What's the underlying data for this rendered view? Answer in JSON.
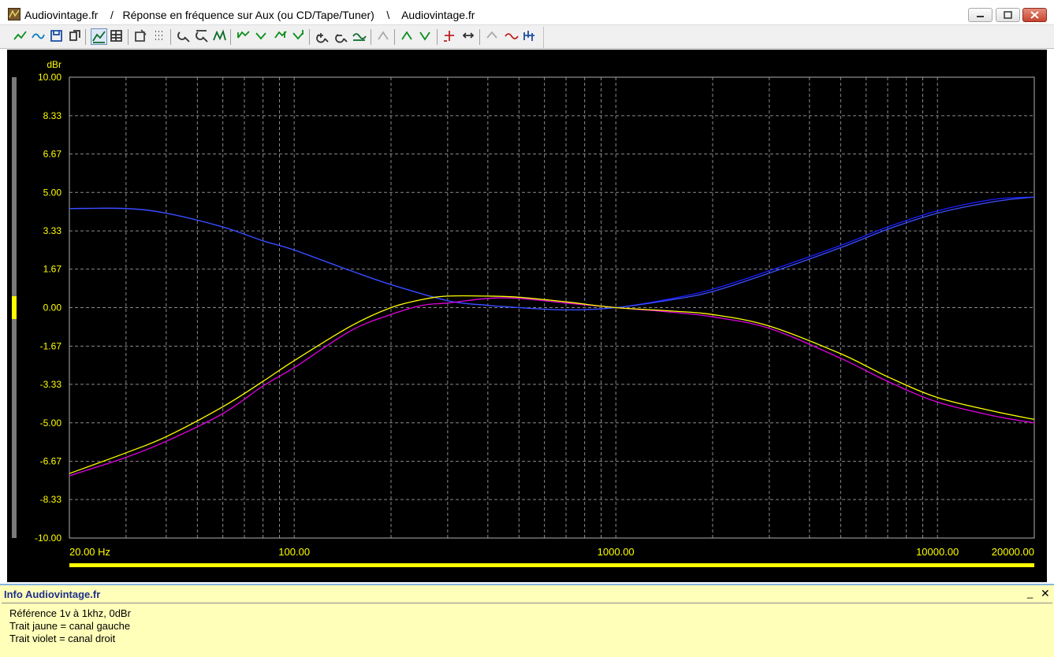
{
  "window": {
    "title": "Audiovintage.fr    /   Réponse en fréquence sur Aux (ou CD/Tape/Tuner)    \\    Audiovintage.fr",
    "accent_color": "#c7452f"
  },
  "toolbar": {
    "icons": [
      "curve-add-icon",
      "curve-smooth-icon",
      "save-icon",
      "copy-icon",
      "fill-graph-icon",
      "chart-table-icon",
      "edit-icon",
      "grid-dots-icon",
      "zoom-fit-icon",
      "zoom-area-icon",
      "curve-view-icon",
      "peak-left-icon",
      "peak-down-icon",
      "peak-right-icon",
      "peak-select-icon",
      "zoom-in-icon",
      "zoom-out-icon",
      "normalize-icon",
      "disabled-tool-icon",
      "peak-up-icon",
      "valley-icon",
      "markers-icon",
      "marker-move-icon",
      "disabled-arrow-icon",
      "wave-icon",
      "align-icon"
    ]
  },
  "chart_data": {
    "type": "line",
    "ylabel": "dBr",
    "ylim": [
      -10,
      10
    ],
    "xlim": [
      20,
      20000
    ],
    "x_scale": "log",
    "y_ticks": [
      "10.00",
      "8.33",
      "6.67",
      "5.00",
      "3.33",
      "1.67",
      "0.00",
      "-1.67",
      "-3.33",
      "-5.00",
      "-6.67",
      "-8.33",
      "-10.00"
    ],
    "x_ticks": [
      {
        "value": 20,
        "label": "20.00 Hz"
      },
      {
        "value": 100,
        "label": "100.00"
      },
      {
        "value": 1000,
        "label": "1000.00"
      },
      {
        "value": 10000,
        "label": "10000.00"
      },
      {
        "value": 20000,
        "label": "20000.00"
      }
    ],
    "grid": true,
    "background": "#000000",
    "axis_text_color": "#ffff00",
    "grid_color": "#8a8a8a",
    "series": [
      {
        "color": "#1c1cff",
        "points": [
          [
            20,
            4.3
          ],
          [
            30,
            4.3
          ],
          [
            40,
            4.1
          ],
          [
            60,
            3.5
          ],
          [
            80,
            2.9
          ],
          [
            100,
            2.5
          ],
          [
            150,
            1.6
          ],
          [
            200,
            1.0
          ],
          [
            300,
            0.3
          ],
          [
            400,
            0.1
          ],
          [
            500,
            0.0
          ],
          [
            700,
            -0.1
          ],
          [
            1000,
            0.0
          ],
          [
            1500,
            0.4
          ],
          [
            2000,
            0.8
          ],
          [
            3000,
            1.6
          ],
          [
            5000,
            2.7
          ],
          [
            7000,
            3.5
          ],
          [
            10000,
            4.2
          ],
          [
            15000,
            4.7
          ],
          [
            20000,
            4.8
          ]
        ]
      },
      {
        "color": "#3a50ff",
        "points": [
          [
            20,
            4.3
          ],
          [
            30,
            4.3
          ],
          [
            40,
            4.1
          ],
          [
            60,
            3.5
          ],
          [
            80,
            2.9
          ],
          [
            100,
            2.5
          ],
          [
            150,
            1.6
          ],
          [
            200,
            1.0
          ],
          [
            300,
            0.3
          ],
          [
            400,
            0.1
          ],
          [
            500,
            0.0
          ],
          [
            700,
            -0.1
          ],
          [
            1000,
            0.0
          ],
          [
            1500,
            0.35
          ],
          [
            2000,
            0.7
          ],
          [
            3000,
            1.5
          ],
          [
            5000,
            2.6
          ],
          [
            7000,
            3.4
          ],
          [
            10000,
            4.1
          ],
          [
            15000,
            4.6
          ],
          [
            20000,
            4.8
          ]
        ]
      },
      {
        "color": "#e000e0",
        "points": [
          [
            20,
            -7.3
          ],
          [
            30,
            -6.5
          ],
          [
            40,
            -5.8
          ],
          [
            60,
            -4.6
          ],
          [
            80,
            -3.4
          ],
          [
            100,
            -2.6
          ],
          [
            150,
            -1.0
          ],
          [
            200,
            -0.3
          ],
          [
            250,
            0.1
          ],
          [
            300,
            0.2
          ],
          [
            400,
            0.4
          ],
          [
            500,
            0.4
          ],
          [
            700,
            0.2
          ],
          [
            1000,
            0.0
          ],
          [
            1500,
            -0.2
          ],
          [
            2000,
            -0.4
          ],
          [
            3000,
            -0.9
          ],
          [
            5000,
            -2.2
          ],
          [
            7000,
            -3.2
          ],
          [
            10000,
            -4.1
          ],
          [
            15000,
            -4.7
          ],
          [
            20000,
            -5.0
          ]
        ]
      },
      {
        "color": "#ffff00",
        "points": [
          [
            20,
            -7.2
          ],
          [
            30,
            -6.3
          ],
          [
            40,
            -5.6
          ],
          [
            60,
            -4.3
          ],
          [
            80,
            -3.2
          ],
          [
            100,
            -2.3
          ],
          [
            150,
            -0.8
          ],
          [
            200,
            0.0
          ],
          [
            250,
            0.35
          ],
          [
            300,
            0.5
          ],
          [
            400,
            0.5
          ],
          [
            500,
            0.45
          ],
          [
            700,
            0.25
          ],
          [
            1000,
            0.0
          ],
          [
            1500,
            -0.15
          ],
          [
            2000,
            -0.3
          ],
          [
            3000,
            -0.8
          ],
          [
            5000,
            -2.0
          ],
          [
            7000,
            -3.0
          ],
          [
            10000,
            -3.9
          ],
          [
            15000,
            -4.5
          ],
          [
            20000,
            -4.85
          ]
        ]
      }
    ]
  },
  "info": {
    "title": "Info Audiovintage.fr",
    "lines": [
      "Référence 1v à 1khz, 0dBr",
      "Trait jaune = canal gauche",
      "Trait violet = canal droit"
    ],
    "minimize": "_",
    "close": "✕"
  }
}
